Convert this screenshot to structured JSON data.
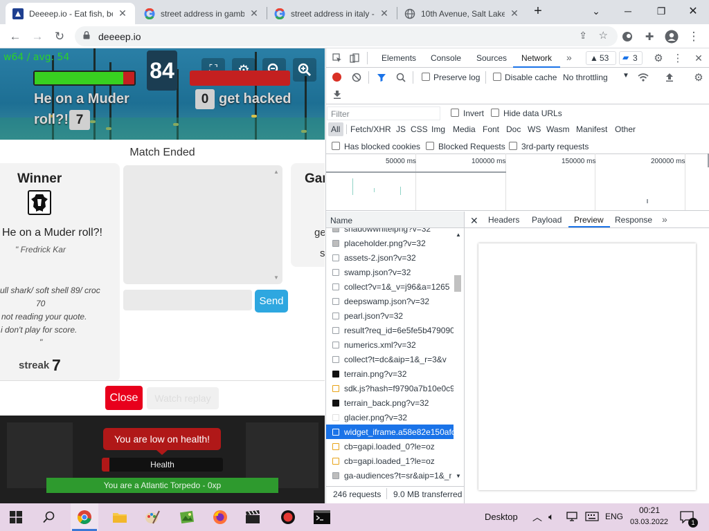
{
  "browser": {
    "tabs": [
      {
        "title": "Deeeep.io - Eat fish, be",
        "favicon": "deeeep-favicon",
        "active": true
      },
      {
        "title": "street address in gamb",
        "favicon": "google-favicon",
        "active": false
      },
      {
        "title": "street address in italy -",
        "favicon": "google-favicon",
        "active": false
      },
      {
        "title": "10th Avenue, Salt Lake",
        "favicon": "globe-favicon",
        "active": false
      }
    ],
    "url": "deeeep.io"
  },
  "game": {
    "fps_text": "w64 / avg. 54",
    "score": "84",
    "hp_fraction": 0.89,
    "player_left": {
      "name": "He on a Muder",
      "name_line2": "roll?!",
      "kills": "7"
    },
    "player_right": {
      "kills": "0",
      "name": "get hacked"
    },
    "match_status": "Match Ended",
    "winner": {
      "title": "Winner",
      "name": "He on a Muder roll?!",
      "by": "\" Fredrick Kar",
      "quote_lines": [
        "ull shark/ soft shell 89/ croc",
        "70",
        "not reading your quote.",
        "i don't play for score.",
        "\""
      ],
      "streak_label": "streak",
      "streak_value": "7"
    },
    "game_panel": {
      "title": "Gar",
      "line1": "ge",
      "line2": "s"
    },
    "send_label": "Send",
    "close_label": "Close",
    "watch_label": "Watch replay",
    "low_health": "You are low on health!",
    "health_label": "Health",
    "health_fraction": 0.06,
    "xp_text": "You are a Atlantic Torpedo - 0xp"
  },
  "devtools": {
    "tabs": [
      "Elements",
      "Console",
      "Sources",
      "Network"
    ],
    "active_tab": "Network",
    "warnings": "53",
    "messages": "3",
    "preserve_log": "Preserve log",
    "disable_cache": "Disable cache",
    "throttling": "No throttling",
    "filter_placeholder": "Filter",
    "invert": "Invert",
    "hide_data_urls": "Hide data URLs",
    "types": [
      "All",
      "Fetch/XHR",
      "JS",
      "CSS",
      "Img",
      "Media",
      "Font",
      "Doc",
      "WS",
      "Wasm",
      "Manifest",
      "Other"
    ],
    "blocked_cookies": "Has blocked cookies",
    "blocked_requests": "Blocked Requests",
    "third_party": "3rd-party requests",
    "ticks": [
      "50000 ms",
      "100000 ms",
      "150000 ms",
      "200000 ms"
    ],
    "name_header": "Name",
    "requests": [
      {
        "name": "shadowwhitelpng?v=32",
        "type": "img"
      },
      {
        "name": "placeholder.png?v=32",
        "type": "img"
      },
      {
        "name": "assets-2.json?v=32",
        "type": "doc"
      },
      {
        "name": "swamp.json?v=32",
        "type": "doc"
      },
      {
        "name": "collect?v=1&_v=j96&a=1265",
        "type": "doc"
      },
      {
        "name": "deepswamp.json?v=32",
        "type": "doc"
      },
      {
        "name": "pearl.json?v=32",
        "type": "doc"
      },
      {
        "name": "result?req_id=6e5fe5b479090",
        "type": "doc"
      },
      {
        "name": "numerics.xml?v=32",
        "type": "doc"
      },
      {
        "name": "collect?t=dc&aip=1&_r=3&v",
        "type": "doc"
      },
      {
        "name": "terrain.png?v=32",
        "type": "black"
      },
      {
        "name": "sdk.js?hash=f9790a7b10e0c9",
        "type": "script"
      },
      {
        "name": "terrain_back.png?v=32",
        "type": "black"
      },
      {
        "name": "glacier.png?v=32",
        "type": "white"
      },
      {
        "name": "widget_iframe.a58e82e150afc",
        "type": "doc",
        "selected": true
      },
      {
        "name": "cb=gapi.loaded_0?le=oz",
        "type": "script"
      },
      {
        "name": "cb=gapi.loaded_1?le=oz",
        "type": "script"
      },
      {
        "name": "ga-audiences?t=sr&aip=1&_r",
        "type": "img"
      }
    ],
    "detail_tabs": [
      "Headers",
      "Payload",
      "Preview",
      "Response"
    ],
    "active_detail_tab": "Preview",
    "status_requests": "246 requests",
    "status_transferred": "9.0 MB transferred"
  },
  "taskbar": {
    "desktop": "Desktop",
    "lang": "ENG",
    "time": "00:21",
    "date": "03.03.2022",
    "notif_count": "1"
  }
}
